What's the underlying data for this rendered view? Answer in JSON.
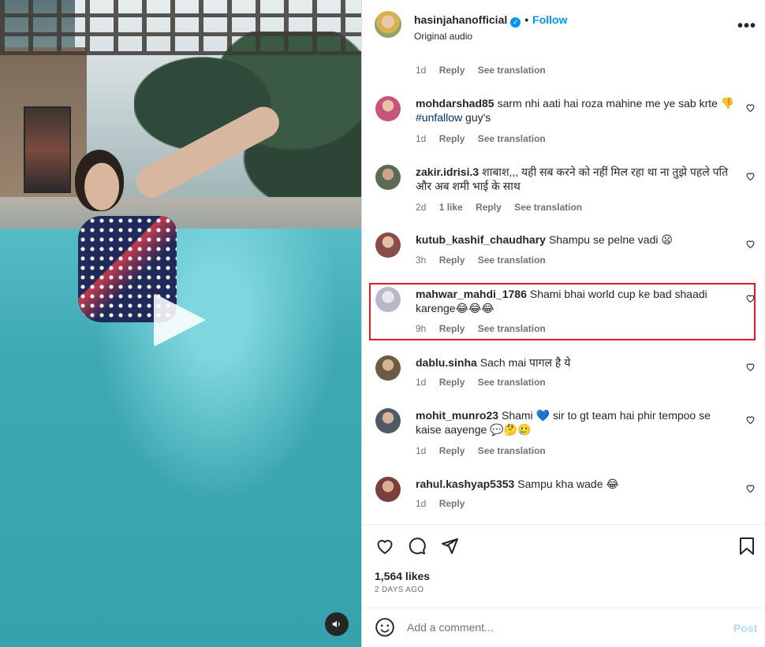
{
  "post": {
    "username": "hasinjahanofficial",
    "follow_label": "Follow",
    "audio": "Original audio"
  },
  "first_meta": {
    "time": "1d",
    "reply": "Reply",
    "translate": "See translation"
  },
  "comments": [
    {
      "user": "mohdarshad85",
      "text": "sarm nhi aati hai roza mahine me ye sab krte 👎",
      "line2_tag": "#unfallow",
      "line2_rest": " guy's",
      "time": "1d",
      "likes": "",
      "reply": "Reply",
      "translate": "See translation",
      "avatar_color": "#c8567a"
    },
    {
      "user": "zakir.idrisi.3",
      "text": "शाबाश,,, यही सब करने को नहीं मिल रहा था ना तुझे पहले पति और अब शमी भाई के साथ",
      "time": "2d",
      "likes": "1 like",
      "reply": "Reply",
      "translate": "See translation",
      "avatar_color": "#5b6b55"
    },
    {
      "user": "kutub_kashif_chaudhary",
      "text": "Shampu se pelne vadi 😦",
      "time": "3h",
      "likes": "",
      "reply": "Reply",
      "translate": "See translation",
      "avatar_color": "#8a4b4b"
    },
    {
      "user": "mahwar_mahdi_1786",
      "text": "Shami bhai world cup ke bad shaadi karenge😂😂😂",
      "time": "9h",
      "likes": "",
      "reply": "Reply",
      "translate": "See translation",
      "avatar_color": "#b9b7c9"
    },
    {
      "user": "dablu.sinha",
      "text": "Sach mai पागल है ये",
      "time": "1d",
      "likes": "",
      "reply": "Reply",
      "translate": "See translation",
      "avatar_color": "#6d5a44"
    },
    {
      "user": "mohit_munro23",
      "text": "Shami 💙 sir to gt team hai phir tempoo se kaise aayenge 💬🤔🥲",
      "time": "1d",
      "likes": "",
      "reply": "Reply",
      "translate": "See translation",
      "avatar_color": "#4f5a66"
    },
    {
      "user": "rahul.kashyap5353",
      "text": "Sampu kha wade 😂",
      "time": "1d",
      "likes": "",
      "reply": "Reply",
      "translate": "",
      "avatar_color": "#7a3f3a"
    }
  ],
  "footer": {
    "likes": "1,564 likes",
    "ago": "2 DAYS AGO",
    "add_comment_placeholder": "Add a comment...",
    "post_label": "Post"
  },
  "icons": {
    "like": "heart-icon",
    "comment": "comment-icon",
    "share": "send-icon",
    "save": "bookmark-icon",
    "emoji": "emoji-icon",
    "mute": "speaker-icon",
    "play": "play-icon",
    "more": "more-options-icon"
  },
  "colors": {
    "accent": "#0095f6",
    "highlight": "#d62027"
  }
}
